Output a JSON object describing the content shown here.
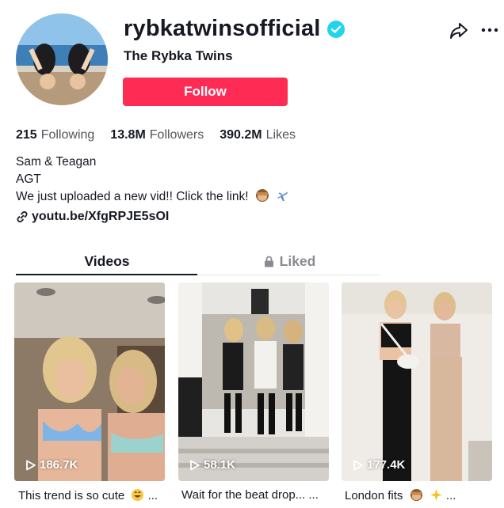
{
  "profile": {
    "username": "rybkatwinsofficial",
    "nickname": "The Rybka Twins",
    "follow_label": "Follow",
    "verified": true,
    "accent_color": "#fe2c55"
  },
  "stats": {
    "following_count": "215",
    "following_label": "Following",
    "followers_count": "13.8M",
    "followers_label": "Followers",
    "likes_count": "390.2M",
    "likes_label": "Likes"
  },
  "bio": {
    "line1": "Sam & Teagan",
    "line2": "AGT",
    "line3": "We just uploaded a new vid!! Click the link!",
    "line3_emojis": [
      "see-no-evil-monkey",
      "airplane"
    ]
  },
  "link": {
    "text": "youtube.com/XfgRPJE5sOI",
    "display": "youtu.be/XfgRPJE5sOI"
  },
  "tabs": [
    {
      "label": "Videos",
      "active": true
    },
    {
      "label": "Liked",
      "active": false,
      "icon": "lock-icon"
    }
  ],
  "videos": [
    {
      "views": "186.7K",
      "caption": "This trend is so cute",
      "caption_emoji": "grinning-face",
      "caption_suffix": "..."
    },
    {
      "views": "58.1K",
      "caption": "Wait for the beat drop... ...",
      "caption_emoji": "",
      "caption_suffix": ""
    },
    {
      "views": "177.4K",
      "caption": "London fits",
      "caption_emoji": "see-no-evil-monkey",
      "caption_emoji2": "sparkles",
      "caption_suffix": "..."
    }
  ]
}
